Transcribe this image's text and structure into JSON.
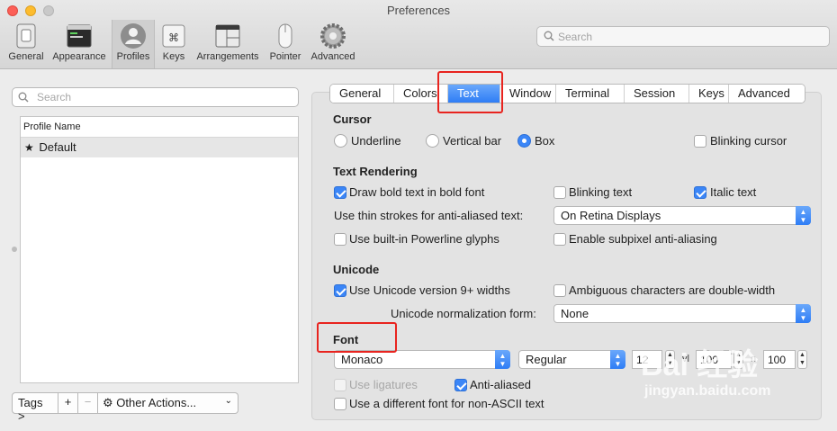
{
  "window": {
    "title": "Preferences"
  },
  "toolbar": {
    "items": [
      {
        "label": "General",
        "icon": "general-switch-icon"
      },
      {
        "label": "Appearance",
        "icon": "appearance-window-icon"
      },
      {
        "label": "Profiles",
        "icon": "profiles-person-icon",
        "selected": true
      },
      {
        "label": "Keys",
        "icon": "keys-command-icon"
      },
      {
        "label": "Arrangements",
        "icon": "arrangements-windows-icon"
      },
      {
        "label": "Pointer",
        "icon": "pointer-mouse-icon"
      },
      {
        "label": "Advanced",
        "icon": "advanced-gear-icon"
      }
    ],
    "search_placeholder": "Search"
  },
  "sidebar": {
    "search_placeholder": "Search",
    "list_header": "Profile Name",
    "profiles": [
      {
        "name": "Default",
        "star": "★"
      }
    ],
    "tags_button": "Tags >",
    "add_button": "+",
    "remove_button": "−",
    "actions_button": "Other Actions...",
    "actions_chevron": "⌄"
  },
  "tabs": [
    "General",
    "Colors",
    "Text",
    "Window",
    "Terminal",
    "Session",
    "Keys",
    "Advanced"
  ],
  "selected_tab": "Text",
  "cursor": {
    "title": "Cursor",
    "options": [
      "Underline",
      "Vertical bar",
      "Box"
    ],
    "selected": "Box",
    "blinking_label": "Blinking cursor",
    "blinking": false
  },
  "text_rendering": {
    "title": "Text Rendering",
    "bold_label": "Draw bold text in bold font",
    "bold": true,
    "blinking_text_label": "Blinking text",
    "blinking_text": false,
    "italic_label": "Italic text",
    "italic": true,
    "thin_strokes_label": "Use thin strokes for anti-aliased text:",
    "thin_strokes_value": "On Retina Displays",
    "powerline_label": "Use built-in Powerline glyphs",
    "powerline": false,
    "subpixel_label": "Enable subpixel anti-aliasing",
    "subpixel": false
  },
  "unicode": {
    "title": "Unicode",
    "v9_label": "Use Unicode version 9+ widths",
    "v9": true,
    "ambiguous_label": "Ambiguous characters are double-width",
    "ambiguous": false,
    "normalization_label": "Unicode normalization form:",
    "normalization_value": "None"
  },
  "font": {
    "title": "Font",
    "family": "Monaco",
    "style": "Regular",
    "size": "12",
    "vl_label": "vl",
    "vl_value": "100",
    "n_label": "n",
    "n_value": "100",
    "ligatures_label": "Use ligatures",
    "ligatures": false,
    "antialiased_label": "Anti-aliased",
    "antialiased": true,
    "non_ascii_label": "Use a different font for non-ASCII text",
    "non_ascii": false
  },
  "watermark": {
    "logo": "Bai 经验",
    "url": "jingyan.baidu.com"
  },
  "colors": {
    "accent": "#3b86f7",
    "highlight": "#e8241f"
  }
}
